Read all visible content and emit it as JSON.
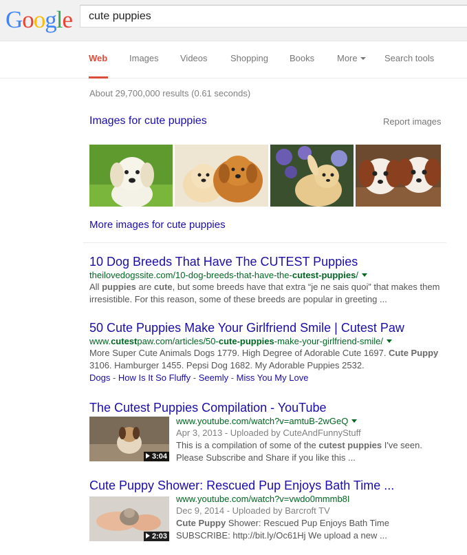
{
  "logo": {
    "letters": [
      "G",
      "o",
      "o",
      "g",
      "l",
      "e"
    ],
    "colors": [
      "#4285f4",
      "#ea4335",
      "#fbbc05",
      "#4285f4",
      "#34a853",
      "#ea4335"
    ]
  },
  "search": {
    "query": "cute puppies"
  },
  "tabs": [
    {
      "label": "Web",
      "active": true
    },
    {
      "label": "Images"
    },
    {
      "label": "Videos"
    },
    {
      "label": "Shopping"
    },
    {
      "label": "Books"
    },
    {
      "label": "More"
    },
    {
      "label": "Search tools"
    }
  ],
  "stats": "About 29,700,000 results (0.61 seconds)",
  "images_section": {
    "heading": "Images for cute puppies",
    "report": "Report images",
    "more_link": "More images for cute puppies"
  },
  "results": [
    {
      "title": "10 Dog Breeds That Have The CUTEST Puppies",
      "url_pre": "theilovedogssite.com/10-dog-breeds-that-have-the-",
      "url_bold": "cutest-puppies",
      "url_post": "/",
      "snippet_1": "All ",
      "snippet_b1": "puppies",
      "snippet_2": " are ",
      "snippet_b2": "cute",
      "snippet_3": ", but some breeds have that extra “je ne sais quoi” that makes them irresistible. For this reason, some of these breeds are popular in greeting ..."
    },
    {
      "title": "50 Cute Puppies Make Your Girlfriend Smile | Cutest Paw",
      "url_pre": "www.",
      "url_b1": "cutest",
      "url_mid": "paw.com/articles/50-",
      "url_b2": "cute-puppies",
      "url_post": "-make-your-girlfriend-smile/",
      "snippet_1": "More Super Cute Animals Dogs 1779. High Degree of Adorable Cute 1697. ",
      "snippet_b1": "Cute Puppy",
      "snippet_2": " 3106. Hamburger 1455. Pepsi Dog 1682. My Adorable Puppies 2532.",
      "sublinks": [
        "Dogs",
        "How Is It So Fluffy",
        "Seemly",
        "Miss You My Love"
      ]
    },
    {
      "title": "The Cutest Puppies Compilation - YouTube",
      "url": "www.youtube.com/watch?v=amtuB-2wGeQ",
      "date": "Apr 3, 2013 - Uploaded by CuteAndFunnyStuff",
      "snippet_1": "This is a compilation of some of the ",
      "snippet_b1": "cutest puppies",
      "snippet_2": " I've seen. Please Subscribe and Share if you like this ...",
      "duration": "3:04"
    },
    {
      "title": "Cute Puppy Shower: Rescued Pup Enjoys Bath Time ...",
      "url": "www.youtube.com/watch?v=vwdo0mmmb8I",
      "date": "Dec 9, 2014 - Uploaded by Barcroft TV",
      "snippet_b1": "Cute Puppy",
      "snippet_1": " Shower: Rescued Pup Enjoys Bath Time",
      "snippet_2": "SUBSCRIBE: http://bit.ly/Oc61Hj We upload a new ...",
      "duration": "2:03"
    }
  ]
}
